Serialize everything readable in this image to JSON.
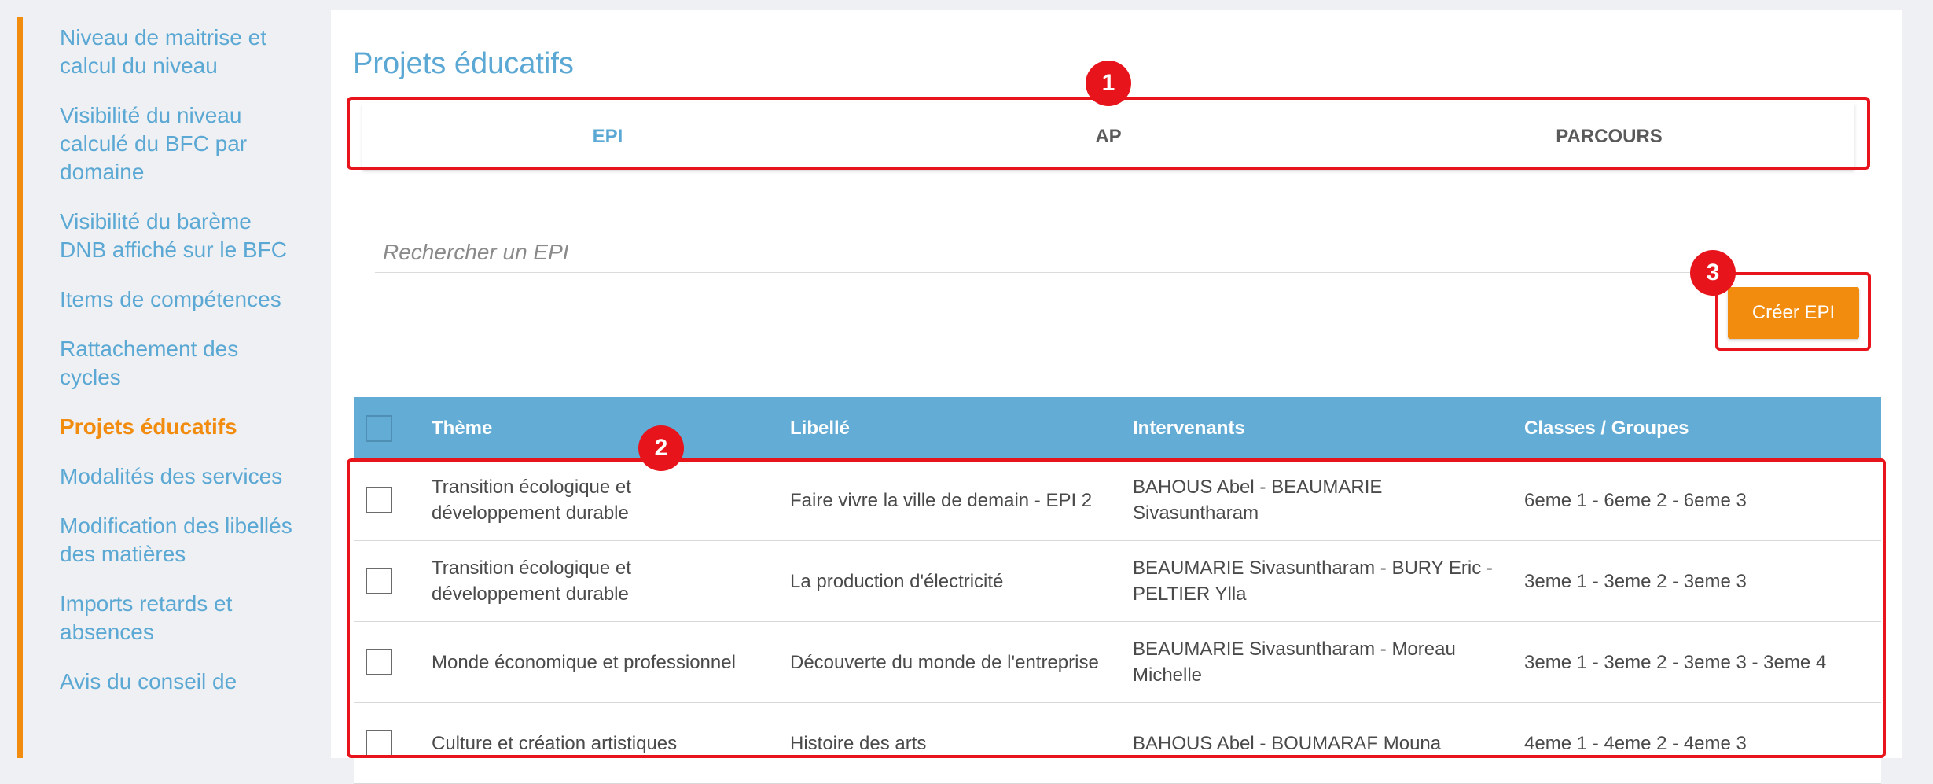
{
  "sidebar": {
    "items": [
      {
        "label": "Niveau de maitrise et calcul du niveau",
        "active": false
      },
      {
        "label": "Visibilité du niveau calculé du BFC par domaine",
        "active": false
      },
      {
        "label": "Visibilité du barème DNB affiché sur le BFC",
        "active": false
      },
      {
        "label": "Items de compétences",
        "active": false
      },
      {
        "label": "Rattachement des cycles",
        "active": false
      },
      {
        "label": "Projets éducatifs",
        "active": true
      },
      {
        "label": "Modalités des services",
        "active": false
      },
      {
        "label": "Modification des libellés des matières",
        "active": false
      },
      {
        "label": "Imports retards et absences",
        "active": false
      },
      {
        "label": "Avis du conseil de",
        "active": false
      }
    ]
  },
  "main": {
    "title": "Projets éducatifs",
    "tabs": [
      {
        "label": "EPI",
        "active": true
      },
      {
        "label": "AP",
        "active": false
      },
      {
        "label": "PARCOURS",
        "active": false
      }
    ],
    "search": {
      "placeholder": "Rechercher un EPI",
      "value": ""
    },
    "create_button": "Créer EPI"
  },
  "table": {
    "headers": [
      "Thème",
      "Libellé",
      "Intervenants",
      "Classes / Groupes"
    ],
    "rows": [
      {
        "theme": "Transition écologique et développement durable",
        "libelle": "Faire vivre la ville de demain - EPI 2",
        "intervenants": "BAHOUS Abel - BEAUMARIE Sivasuntharam",
        "classes": "6eme 1 - 6eme 2 - 6eme 3",
        "checked": false
      },
      {
        "theme": "Transition écologique et développement durable",
        "libelle": "La production d'électricité",
        "intervenants": "BEAUMARIE Sivasuntharam - BURY Eric - PELTIER Ylla",
        "classes": "3eme 1 - 3eme 2 - 3eme 3",
        "checked": false
      },
      {
        "theme": "Monde économique et professionnel",
        "libelle": "Découverte du monde de l'entreprise",
        "intervenants": "BEAUMARIE Sivasuntharam - Moreau Michelle",
        "classes": "3eme 1 - 3eme 2 - 3eme 3 - 3eme 4",
        "checked": false
      },
      {
        "theme": "Culture et création artistiques",
        "libelle": "Histoire des arts",
        "intervenants": "BAHOUS Abel - BOUMARAF Mouna",
        "classes": "4eme 1 - 4eme 2 - 4eme 3",
        "checked": false
      }
    ]
  },
  "annotations": {
    "badges": [
      "1",
      "2",
      "3"
    ],
    "color": "#e8141c"
  },
  "colors": {
    "accent_orange": "#f28c0f",
    "link_blue": "#5aa8d3",
    "table_header": "#63acd5"
  }
}
